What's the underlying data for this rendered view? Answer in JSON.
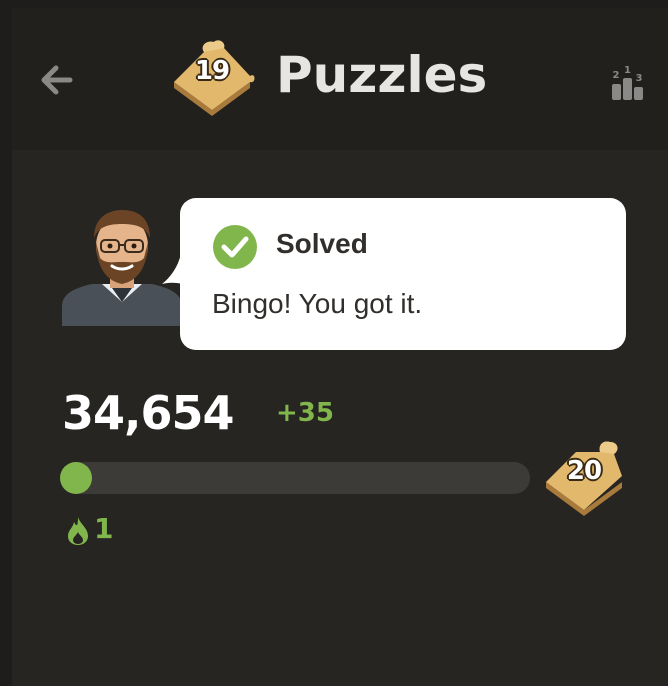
{
  "header": {
    "title": "Puzzles",
    "puzzle_count": "19",
    "back_icon": "arrow-left-icon",
    "leaderboard_icon": "leaderboard-podium-icon",
    "leaderboard_digits": [
      "2",
      "1",
      "3"
    ]
  },
  "feedback": {
    "status": "Solved",
    "message": "Bingo! You got it.",
    "status_icon": "checkmark-circle-icon",
    "status_color": "#81b64c"
  },
  "stats": {
    "rating": "34,654",
    "rating_change": "+35",
    "progress_fraction": 0.06,
    "next_milestone": "20",
    "streak_icon": "flame-icon",
    "streak_count": "1"
  },
  "colors": {
    "accent_green": "#81b64c",
    "background": "#262522",
    "header_background": "#21201d",
    "puzzle_badge": "#e2b86c"
  }
}
